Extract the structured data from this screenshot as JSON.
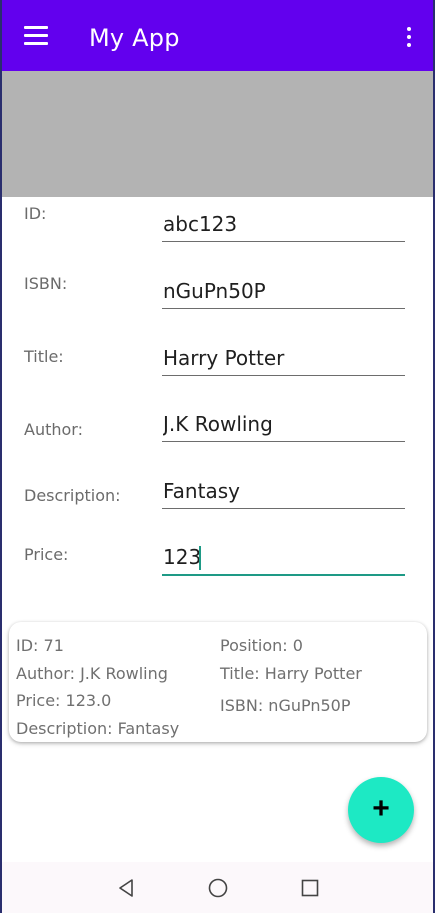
{
  "app_bar": {
    "title": "My App",
    "menu_icon": "menu-icon",
    "overflow_icon": "more-vert-icon",
    "color": "#6200ee"
  },
  "form": {
    "fields": [
      {
        "label": "ID:",
        "value": "abc123"
      },
      {
        "label": "ISBN:",
        "value": "nGuPn50P"
      },
      {
        "label": "Title:",
        "value": "Harry Potter"
      },
      {
        "label": "Author:",
        "value": "J.K Rowling"
      },
      {
        "label": "Description:",
        "value": "Fantasy"
      },
      {
        "label": "Price:",
        "value": "123"
      }
    ],
    "focus_color": "#1e9a86"
  },
  "card": {
    "id": "ID: 71",
    "position": "Position: 0",
    "author": "Author: J.K Rowling",
    "title": "Title: Harry Potter",
    "price": "Price: 123.0",
    "isbn": "ISBN:  nGuPn50P",
    "description": "Description: Fantasy"
  },
  "fab": {
    "icon": "add-icon",
    "label": "+",
    "color": "#1de9c4"
  },
  "nav_bar": {
    "back_icon": "back-icon",
    "home_icon": "home-icon",
    "recents_icon": "recents-icon"
  }
}
